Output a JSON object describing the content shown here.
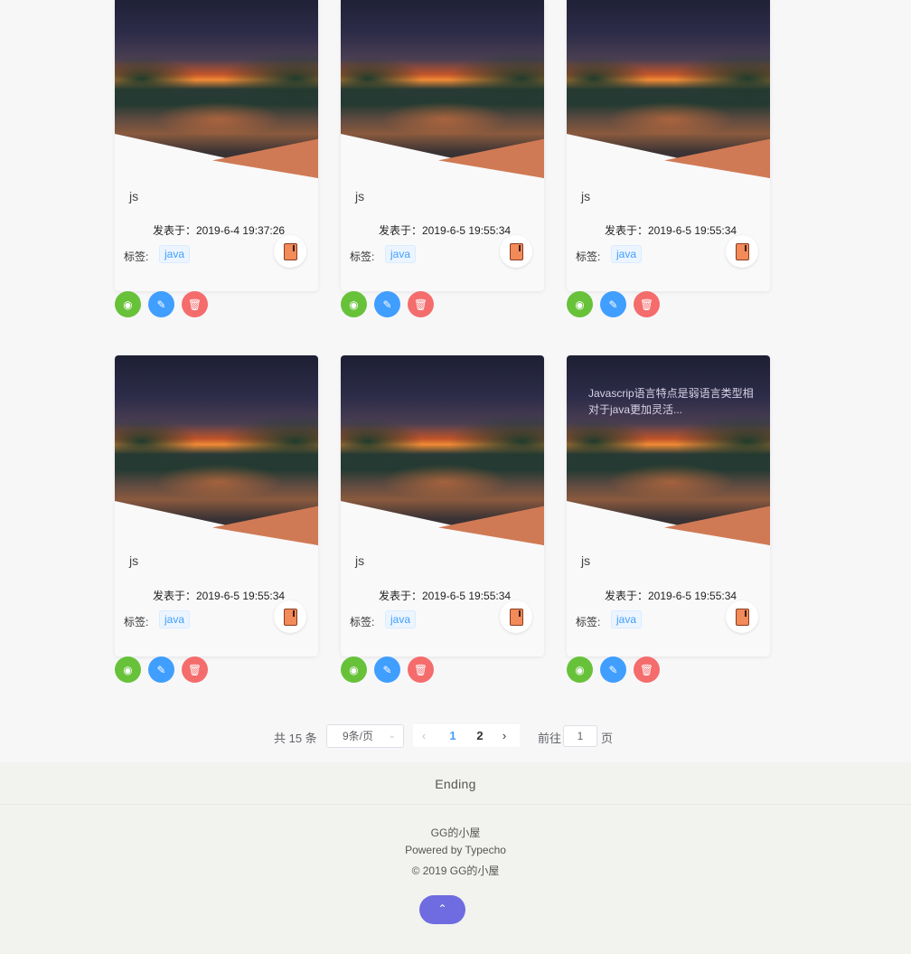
{
  "cards": [
    {
      "title": "js",
      "date": "发表于：2019-6-4 19:37:26",
      "tag_label": "标签:",
      "tag": "java",
      "excerpt": ""
    },
    {
      "title": "js",
      "date": "发表于：2019-6-5 19:55:34",
      "tag_label": "标签:",
      "tag": "java",
      "excerpt": ""
    },
    {
      "title": "js",
      "date": "发表于：2019-6-5 19:55:34",
      "tag_label": "标签:",
      "tag": "java",
      "excerpt": ""
    },
    {
      "title": "js",
      "date": "发表于：2019-6-5 19:55:34",
      "tag_label": "标签:",
      "tag": "java",
      "excerpt": ""
    },
    {
      "title": "js",
      "date": "发表于：2019-6-5 19:55:34",
      "tag_label": "标签:",
      "tag": "java",
      "excerpt": ""
    },
    {
      "title": "js",
      "date": "发表于：2019-6-5 19:55:34",
      "tag_label": "标签:",
      "tag": "java",
      "excerpt": "Javascrip语言特点是弱语言类型相对于java更加灵活..."
    }
  ],
  "pagination": {
    "total": "共 15 条",
    "page_size": "9条/页",
    "pages": [
      "1",
      "2"
    ],
    "current_page": "1",
    "goto_label": "前往",
    "goto_value": "1",
    "goto_suffix": "页"
  },
  "footer": {
    "title": "Ending",
    "site_name": "GG的小屋",
    "powered": "Powered by Typecho",
    "copyright": "© 2019 GG的小屋"
  },
  "icons": {
    "view": "eye-icon",
    "edit": "pencil-icon",
    "delete": "trash-icon",
    "book": "book-icon",
    "back_to_top": "chevron-up-icon"
  },
  "colors": {
    "view_button": "#67c23a",
    "edit_button": "#409eff",
    "delete_button": "#f56c6c",
    "back_to_top": "#6e6ce0",
    "tag_text": "#409eff"
  }
}
